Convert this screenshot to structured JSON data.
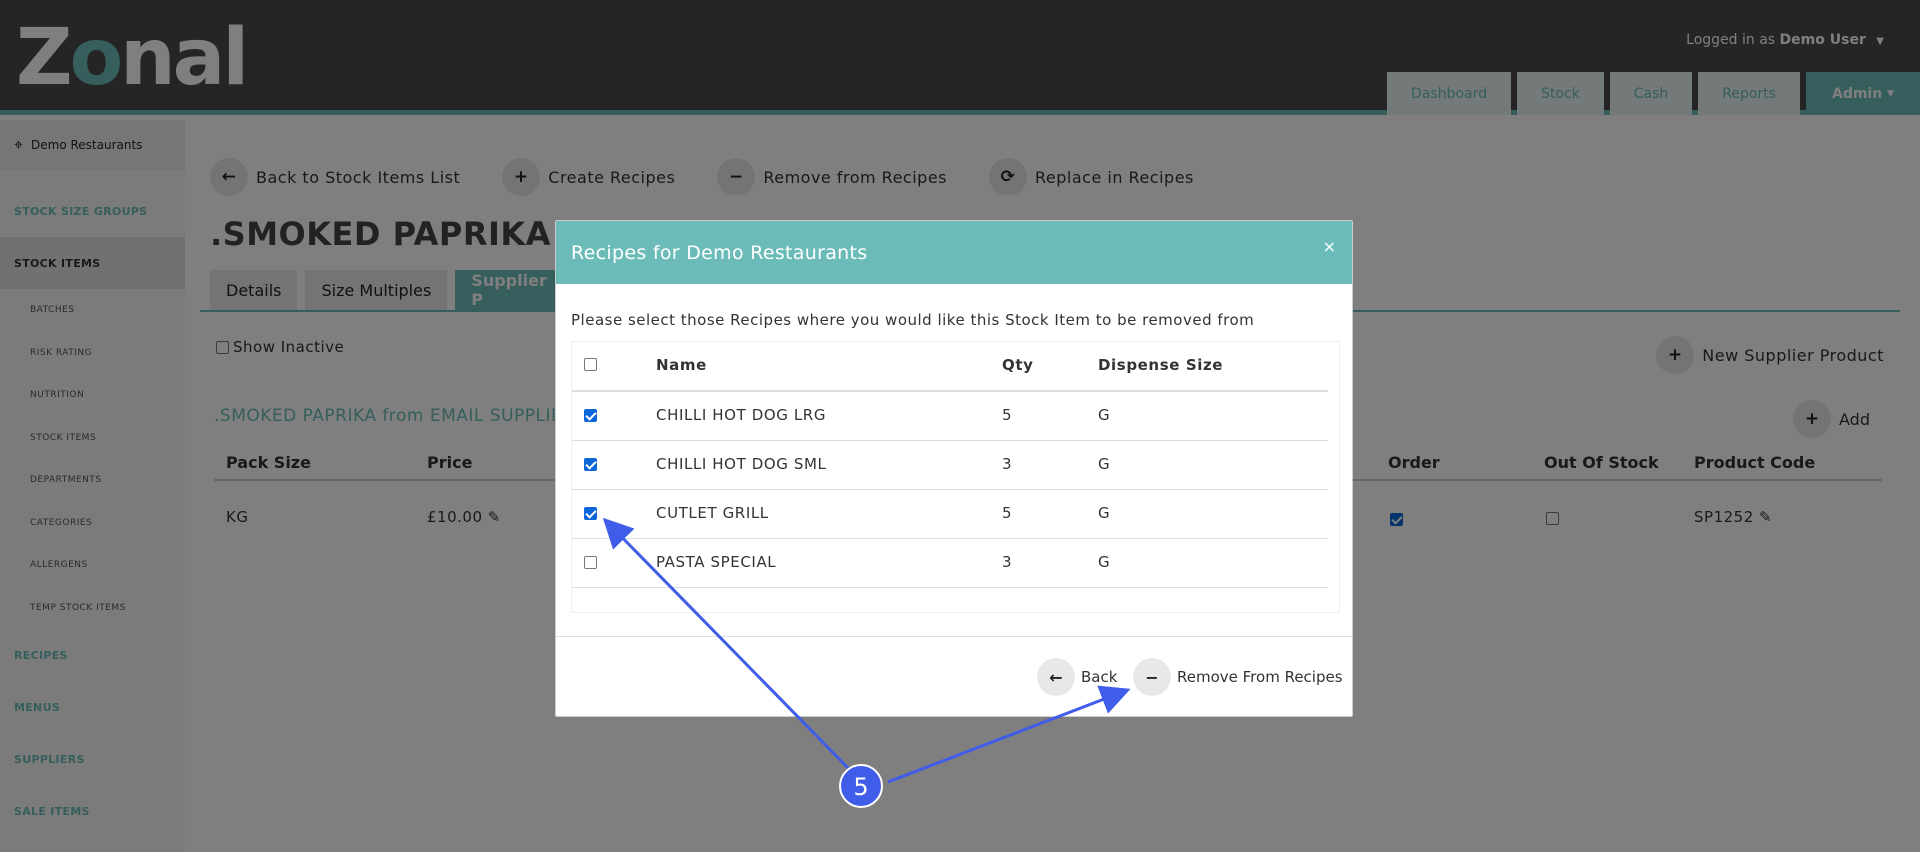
{
  "header": {
    "logo_text": "Zonal",
    "logged_in_prefix": "Logged in as",
    "user_name": "Demo User",
    "nav": [
      "Dashboard",
      "Stock",
      "Cash",
      "Reports",
      "Admin"
    ]
  },
  "sidebar": {
    "site": "Demo Restaurants",
    "items": {
      "stock_size_groups": "STOCK SIZE GROUPS",
      "stock_items": "STOCK ITEMS",
      "recipes": "RECIPES",
      "menus": "MENUS",
      "suppliers": "SUPPLIERS",
      "sale_items": "SALE ITEMS"
    },
    "subitems": [
      "BATCHES",
      "RISK RATING",
      "NUTRITION",
      "STOCK ITEMS",
      "DEPARTMENTS",
      "CATEGORIES",
      "ALLERGENS",
      "TEMP STOCK ITEMS"
    ]
  },
  "toolbar": {
    "back": "Back to Stock Items List",
    "create": "Create Recipes",
    "remove": "Remove from Recipes",
    "replace": "Replace in Recipes"
  },
  "page": {
    "title": ".SMOKED PAPRIKA",
    "tabs": [
      "Details",
      "Size Multiples",
      "Supplier P"
    ],
    "show_inactive": "Show Inactive",
    "new_supplier_product": "New Supplier Product",
    "supplier_heading": ".SMOKED PAPRIKA from EMAIL SUPPLIER",
    "add": "Add",
    "columns": {
      "pack_size": "Pack Size",
      "price": "Price",
      "order": "Order",
      "out_of_stock": "Out Of Stock",
      "product_code": "Product Code"
    },
    "row": {
      "pack_size": "KG",
      "price": "£10.00",
      "order_checked": true,
      "out_of_stock_checked": false,
      "product_code": "SP1252"
    }
  },
  "modal": {
    "title": "Recipes for Demo Restaurants",
    "close": "×",
    "description": "Please select those Recipes where you would like this Stock Item to be removed from",
    "columns": {
      "name": "Name",
      "qty": "Qty",
      "dispense_size": "Dispense Size"
    },
    "rows": [
      {
        "name": "CHILLI HOT DOG LRG",
        "qty": "5",
        "dispense": "G",
        "checked": true
      },
      {
        "name": "CHILLI HOT DOG SML",
        "qty": "3",
        "dispense": "G",
        "checked": true
      },
      {
        "name": "CUTLET GRILL",
        "qty": "5",
        "dispense": "G",
        "checked": true
      },
      {
        "name": "PASTA SPECIAL",
        "qty": "3",
        "dispense": "G",
        "checked": false
      }
    ],
    "back_button": "Back",
    "remove_button": "Remove From Recipes"
  },
  "annotation": {
    "step": "5",
    "color": "#3f5de8"
  },
  "colors": {
    "teal": "#6bbcb8",
    "header_bg": "#4a4a4a"
  }
}
